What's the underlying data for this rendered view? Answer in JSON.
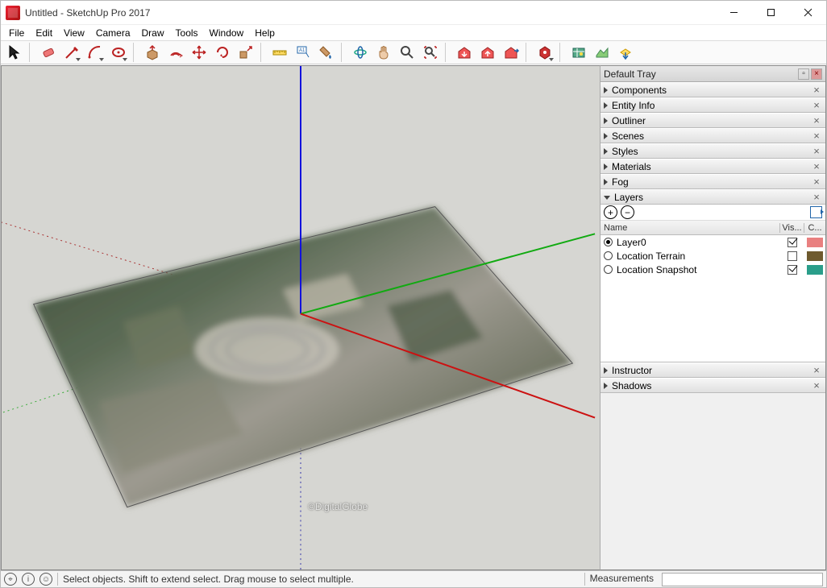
{
  "window": {
    "title": "Untitled - SketchUp Pro 2017"
  },
  "menu": {
    "items": [
      "File",
      "Edit",
      "View",
      "Camera",
      "Draw",
      "Tools",
      "Window",
      "Help"
    ]
  },
  "toolbar": {
    "tools": [
      {
        "name": "select",
        "dd": false
      },
      {
        "name": "eraser",
        "dd": false
      },
      {
        "name": "line",
        "dd": true
      },
      {
        "name": "arc",
        "dd": true
      },
      {
        "name": "shapes",
        "dd": true
      },
      {
        "name": "pushpull",
        "dd": false
      },
      {
        "name": "offset",
        "dd": false
      },
      {
        "name": "move",
        "dd": false
      },
      {
        "name": "rotate",
        "dd": false
      },
      {
        "name": "scale",
        "dd": false
      },
      {
        "name": "tape",
        "dd": false
      },
      {
        "name": "text",
        "dd": false
      },
      {
        "name": "paint",
        "dd": false
      },
      {
        "name": "orbit",
        "dd": false
      },
      {
        "name": "pan",
        "dd": false
      },
      {
        "name": "zoom",
        "dd": false
      },
      {
        "name": "zoom-extents",
        "dd": false
      },
      {
        "name": "get-models",
        "dd": false
      },
      {
        "name": "upload-model",
        "dd": false
      },
      {
        "name": "share-location",
        "dd": false
      },
      {
        "name": "extensions",
        "dd": false
      },
      {
        "name": "add-location",
        "dd": false
      },
      {
        "name": "section",
        "dd": false
      },
      {
        "name": "get-extensions",
        "dd": false
      }
    ]
  },
  "tray": {
    "title": "Default Tray",
    "panels": [
      {
        "name": "Components",
        "expanded": false
      },
      {
        "name": "Entity Info",
        "expanded": false
      },
      {
        "name": "Outliner",
        "expanded": false
      },
      {
        "name": "Scenes",
        "expanded": false
      },
      {
        "name": "Styles",
        "expanded": false
      },
      {
        "name": "Materials",
        "expanded": false
      },
      {
        "name": "Fog",
        "expanded": false
      },
      {
        "name": "Layers",
        "expanded": true
      }
    ],
    "panels_after": [
      {
        "name": "Instructor",
        "expanded": false
      },
      {
        "name": "Shadows",
        "expanded": false
      }
    ],
    "layers": {
      "columns": {
        "name": "Name",
        "vis": "Vis...",
        "col": "C..."
      },
      "rows": [
        {
          "name": "Layer0",
          "selected": true,
          "visible": true,
          "color": "#e98080"
        },
        {
          "name": "Location Terrain",
          "selected": false,
          "visible": false,
          "color": "#6e5a2e"
        },
        {
          "name": "Location Snapshot",
          "selected": false,
          "visible": true,
          "color": "#2a9e8a"
        }
      ]
    }
  },
  "viewport": {
    "watermark": "©DigitalGlobe"
  },
  "status": {
    "hint": "Select objects. Shift to extend select. Drag mouse to select multiple.",
    "measurements_label": "Measurements"
  }
}
